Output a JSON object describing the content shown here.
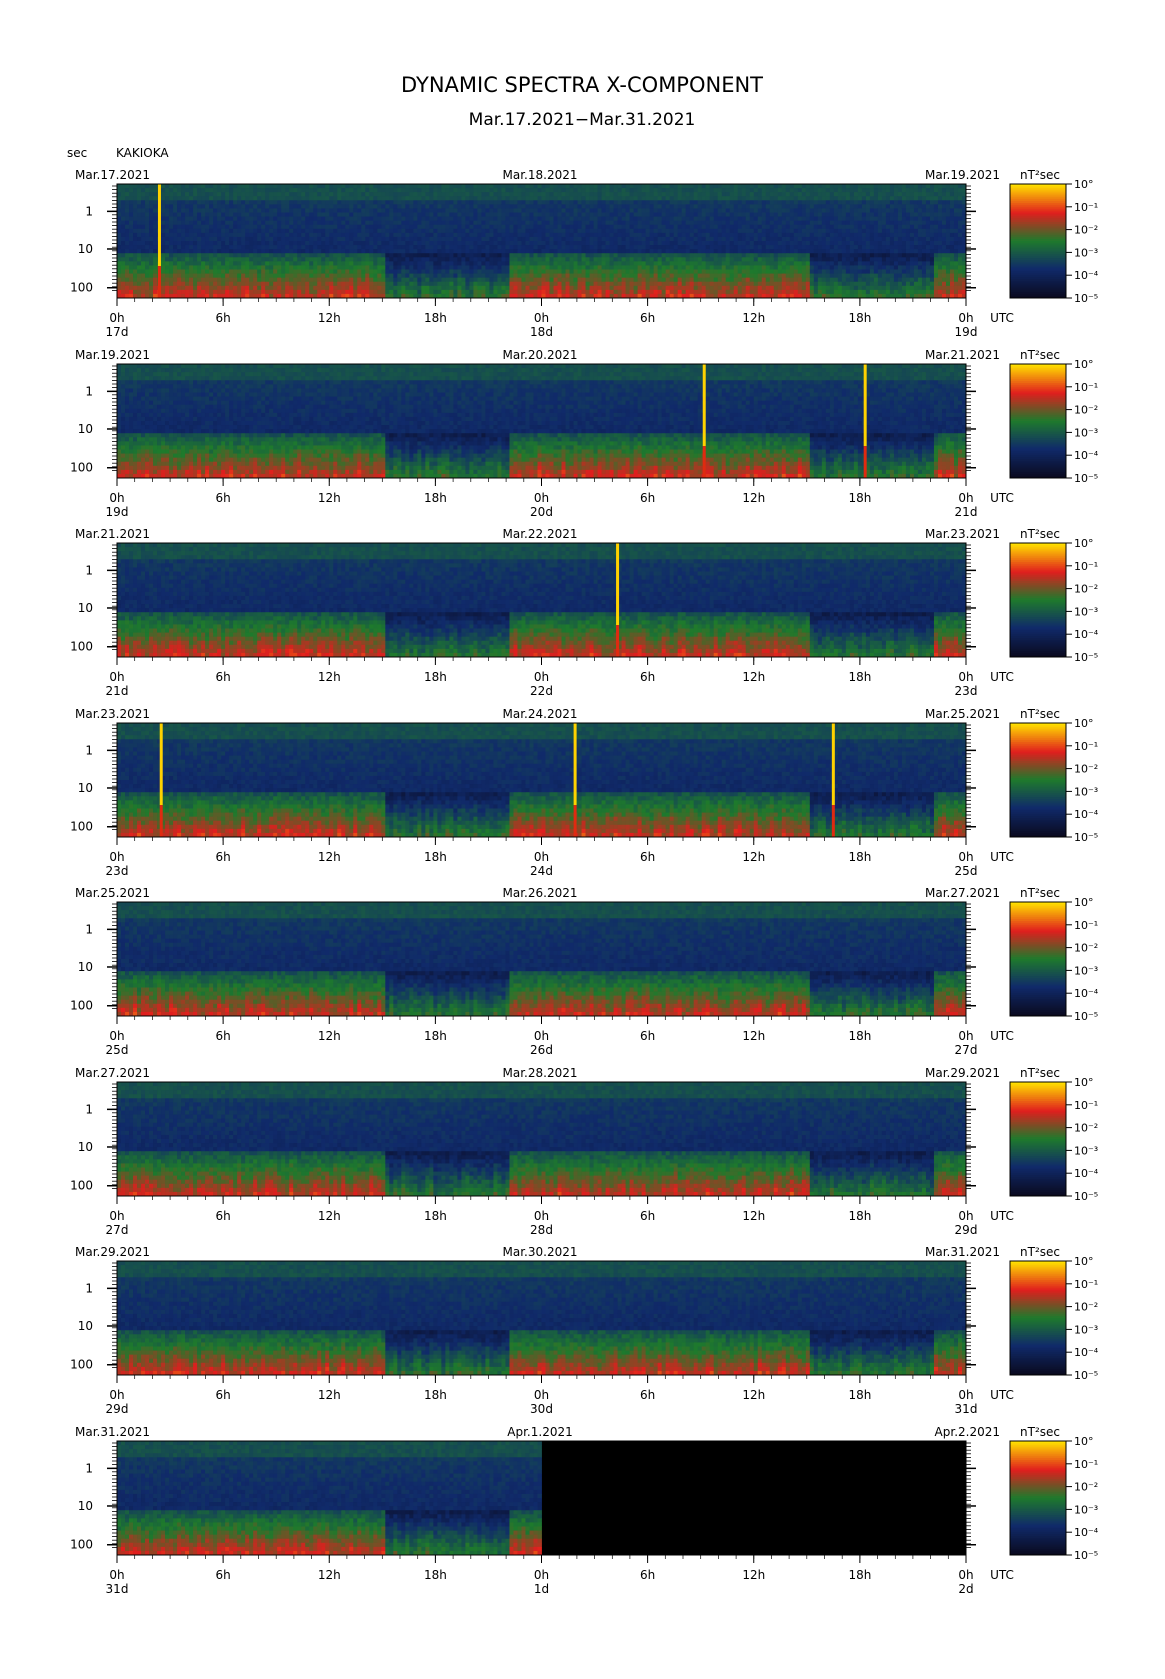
{
  "title": "DYNAMIC SPECTRA X-COMPONENT",
  "subtitle": "Mar.17.2021−Mar.31.2021",
  "yaxis_unit": "sec",
  "station": "KAKIOKA",
  "colorbar_unit": "nT²sec",
  "utc_label": "UTC",
  "colors": {
    "background": "#000000",
    "colormap": [
      "#0a0a20",
      "#102a6a",
      "#1e7a2c",
      "#e01e1e",
      "#ffe000"
    ]
  },
  "chart_data": [
    {
      "type": "heatmap",
      "date_labels": [
        "Mar.17.2021",
        "Mar.18.2021",
        "Mar.19.2021"
      ],
      "x_ticks": [
        "0h",
        "6h",
        "12h",
        "18h",
        "0h",
        "6h",
        "12h",
        "18h",
        "0h"
      ],
      "day_labels": [
        "17d",
        "18d",
        "19d"
      ],
      "y_ticks": [
        "1",
        "10",
        "100"
      ],
      "colorbar_ticks": [
        "10°",
        "10⁻¹",
        "10⁻²",
        "10⁻³",
        "10⁻⁴",
        "10⁻⁵"
      ],
      "spikes": [
        2.4
      ],
      "quiet_from_hours": null
    },
    {
      "type": "heatmap",
      "date_labels": [
        "Mar.19.2021",
        "Mar.20.2021",
        "Mar.21.2021"
      ],
      "x_ticks": [
        "0h",
        "6h",
        "12h",
        "18h",
        "0h",
        "6h",
        "12h",
        "18h",
        "0h"
      ],
      "day_labels": [
        "19d",
        "20d",
        "21d"
      ],
      "y_ticks": [
        "1",
        "10",
        "100"
      ],
      "colorbar_ticks": [
        "10°",
        "10⁻¹",
        "10⁻²",
        "10⁻³",
        "10⁻⁴",
        "10⁻⁵"
      ],
      "spikes": [
        33.2,
        42.3
      ],
      "quiet_from_hours": null
    },
    {
      "type": "heatmap",
      "date_labels": [
        "Mar.21.2021",
        "Mar.22.2021",
        "Mar.23.2021"
      ],
      "x_ticks": [
        "0h",
        "6h",
        "12h",
        "18h",
        "0h",
        "6h",
        "12h",
        "18h",
        "0h"
      ],
      "day_labels": [
        "21d",
        "22d",
        "23d"
      ],
      "y_ticks": [
        "1",
        "10",
        "100"
      ],
      "colorbar_ticks": [
        "10°",
        "10⁻¹",
        "10⁻²",
        "10⁻³",
        "10⁻⁴",
        "10⁻⁵"
      ],
      "spikes": [
        28.3
      ],
      "quiet_from_hours": null
    },
    {
      "type": "heatmap",
      "date_labels": [
        "Mar.23.2021",
        "Mar.24.2021",
        "Mar.25.2021"
      ],
      "x_ticks": [
        "0h",
        "6h",
        "12h",
        "18h",
        "0h",
        "6h",
        "12h",
        "18h",
        "0h"
      ],
      "day_labels": [
        "23d",
        "24d",
        "25d"
      ],
      "y_ticks": [
        "1",
        "10",
        "100"
      ],
      "colorbar_ticks": [
        "10°",
        "10⁻¹",
        "10⁻²",
        "10⁻³",
        "10⁻⁴",
        "10⁻⁵"
      ],
      "spikes": [
        2.5,
        25.9,
        40.5
      ],
      "quiet_from_hours": null
    },
    {
      "type": "heatmap",
      "date_labels": [
        "Mar.25.2021",
        "Mar.26.2021",
        "Mar.27.2021"
      ],
      "x_ticks": [
        "0h",
        "6h",
        "12h",
        "18h",
        "0h",
        "6h",
        "12h",
        "18h",
        "0h"
      ],
      "day_labels": [
        "25d",
        "26d",
        "27d"
      ],
      "y_ticks": [
        "1",
        "10",
        "100"
      ],
      "colorbar_ticks": [
        "10°",
        "10⁻¹",
        "10⁻²",
        "10⁻³",
        "10⁻⁴",
        "10⁻⁵"
      ],
      "spikes": [],
      "quiet_from_hours": null
    },
    {
      "type": "heatmap",
      "date_labels": [
        "Mar.27.2021",
        "Mar.28.2021",
        "Mar.29.2021"
      ],
      "x_ticks": [
        "0h",
        "6h",
        "12h",
        "18h",
        "0h",
        "6h",
        "12h",
        "18h",
        "0h"
      ],
      "day_labels": [
        "27d",
        "28d",
        "29d"
      ],
      "y_ticks": [
        "1",
        "10",
        "100"
      ],
      "colorbar_ticks": [
        "10°",
        "10⁻¹",
        "10⁻²",
        "10⁻³",
        "10⁻⁴",
        "10⁻⁵"
      ],
      "spikes": [],
      "quiet_from_hours": null
    },
    {
      "type": "heatmap",
      "date_labels": [
        "Mar.29.2021",
        "Mar.30.2021",
        "Mar.31.2021"
      ],
      "x_ticks": [
        "0h",
        "6h",
        "12h",
        "18h",
        "0h",
        "6h",
        "12h",
        "18h",
        "0h"
      ],
      "day_labels": [
        "29d",
        "30d",
        "31d"
      ],
      "y_ticks": [
        "1",
        "10",
        "100"
      ],
      "colorbar_ticks": [
        "10°",
        "10⁻¹",
        "10⁻²",
        "10⁻³",
        "10⁻⁴",
        "10⁻⁵"
      ],
      "spikes": [],
      "quiet_from_hours": null
    },
    {
      "type": "heatmap",
      "date_labels": [
        "Mar.31.2021",
        "Apr.1.2021",
        "Apr.2.2021"
      ],
      "x_ticks": [
        "0h",
        "6h",
        "12h",
        "18h",
        "0h",
        "6h",
        "12h",
        "18h",
        "0h"
      ],
      "day_labels": [
        "31d",
        "1d",
        "2d"
      ],
      "y_ticks": [
        "1",
        "10",
        "100"
      ],
      "colorbar_ticks": [
        "10°",
        "10⁻¹",
        "10⁻²",
        "10⁻³",
        "10⁻⁴",
        "10⁻⁵"
      ],
      "spikes": [],
      "quiet_from_hours": 24
    }
  ]
}
